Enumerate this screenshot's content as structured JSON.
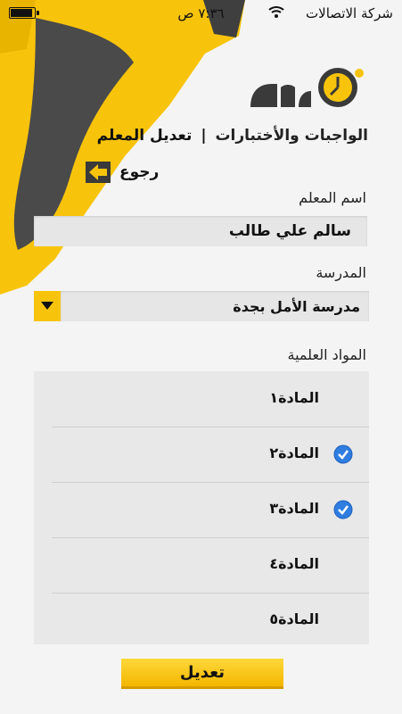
{
  "status_bar": {
    "carrier": "شركة الاتصالات",
    "time": "٧:٣٦ ص"
  },
  "brand": {
    "subtitle": "الواجبات والأختبارات",
    "screen_title": "تعديل المعلم"
  },
  "back": {
    "label": "رجوع"
  },
  "teacher_name": {
    "label": "اسم المعلم",
    "value": "سالم علي طالب"
  },
  "school": {
    "label": "المدرسة",
    "selected": "مدرسة الأمل بجدة"
  },
  "subjects": {
    "label": "المواد العلمية",
    "items": [
      {
        "name": "المادة١",
        "checked": false
      },
      {
        "name": "المادة٢",
        "checked": true
      },
      {
        "name": "المادة٣",
        "checked": true
      },
      {
        "name": "المادة٤",
        "checked": false
      },
      {
        "name": "المادة٥",
        "checked": false
      }
    ]
  },
  "submit": {
    "label": "تعديل"
  },
  "colors": {
    "accent": "#f8c40b",
    "dark": "#3a3a3a",
    "check": "#2f7de0"
  }
}
